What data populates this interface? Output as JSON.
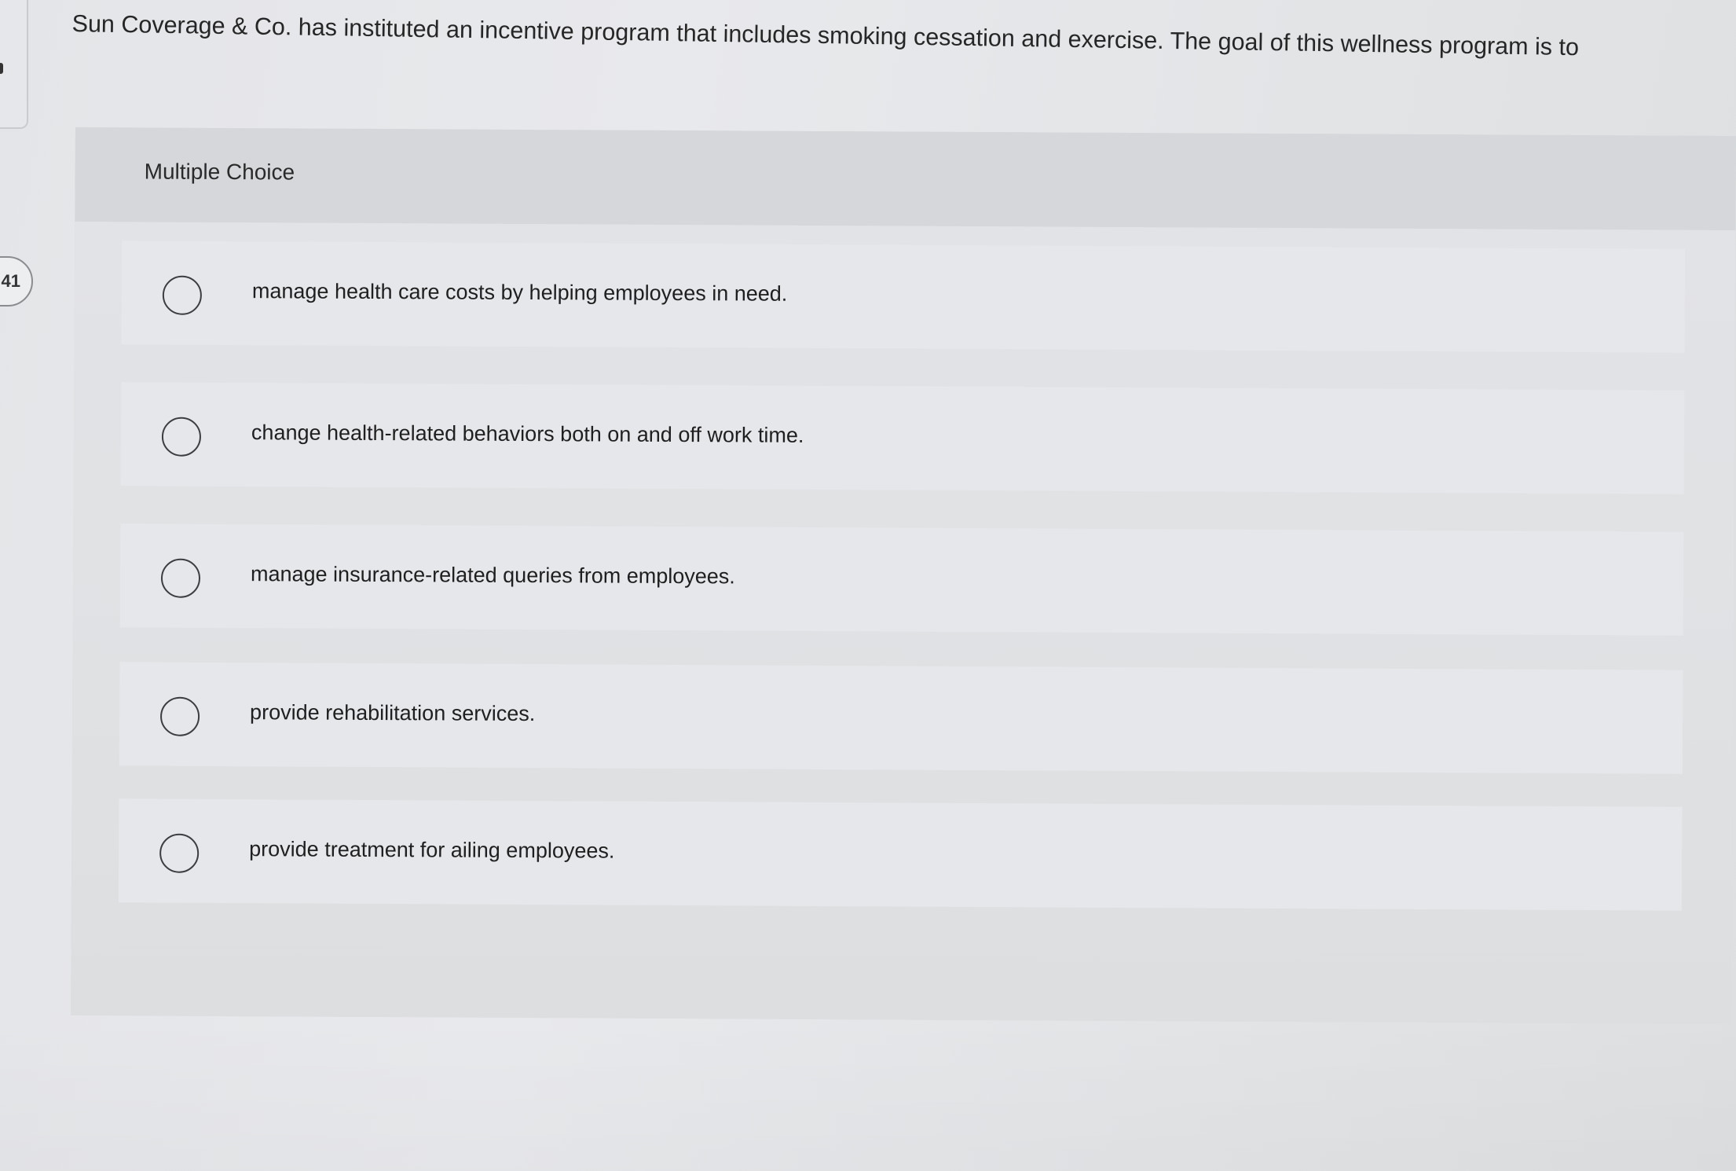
{
  "question": {
    "text": "Sun Coverage & Co. has instituted an incentive program that includes smoking cessation and exercise. The goal of this wellness program is to"
  },
  "timer": {
    "text": ":41"
  },
  "mc": {
    "label": "Multiple Choice",
    "choices": [
      {
        "text": "manage health care costs by helping employees in need."
      },
      {
        "text": "change health-related behaviors both on and off work time."
      },
      {
        "text": "manage insurance-related queries from employees."
      },
      {
        "text": "provide rehabilitation services."
      },
      {
        "text": "provide treatment for ailing employees."
      }
    ]
  },
  "icons": {
    "radio": "radio-unselected-icon"
  },
  "colors": {
    "background": "#e4e5e8",
    "panel": "#d9dbde",
    "text": "#262626",
    "radio_border": "#3b3d40"
  }
}
